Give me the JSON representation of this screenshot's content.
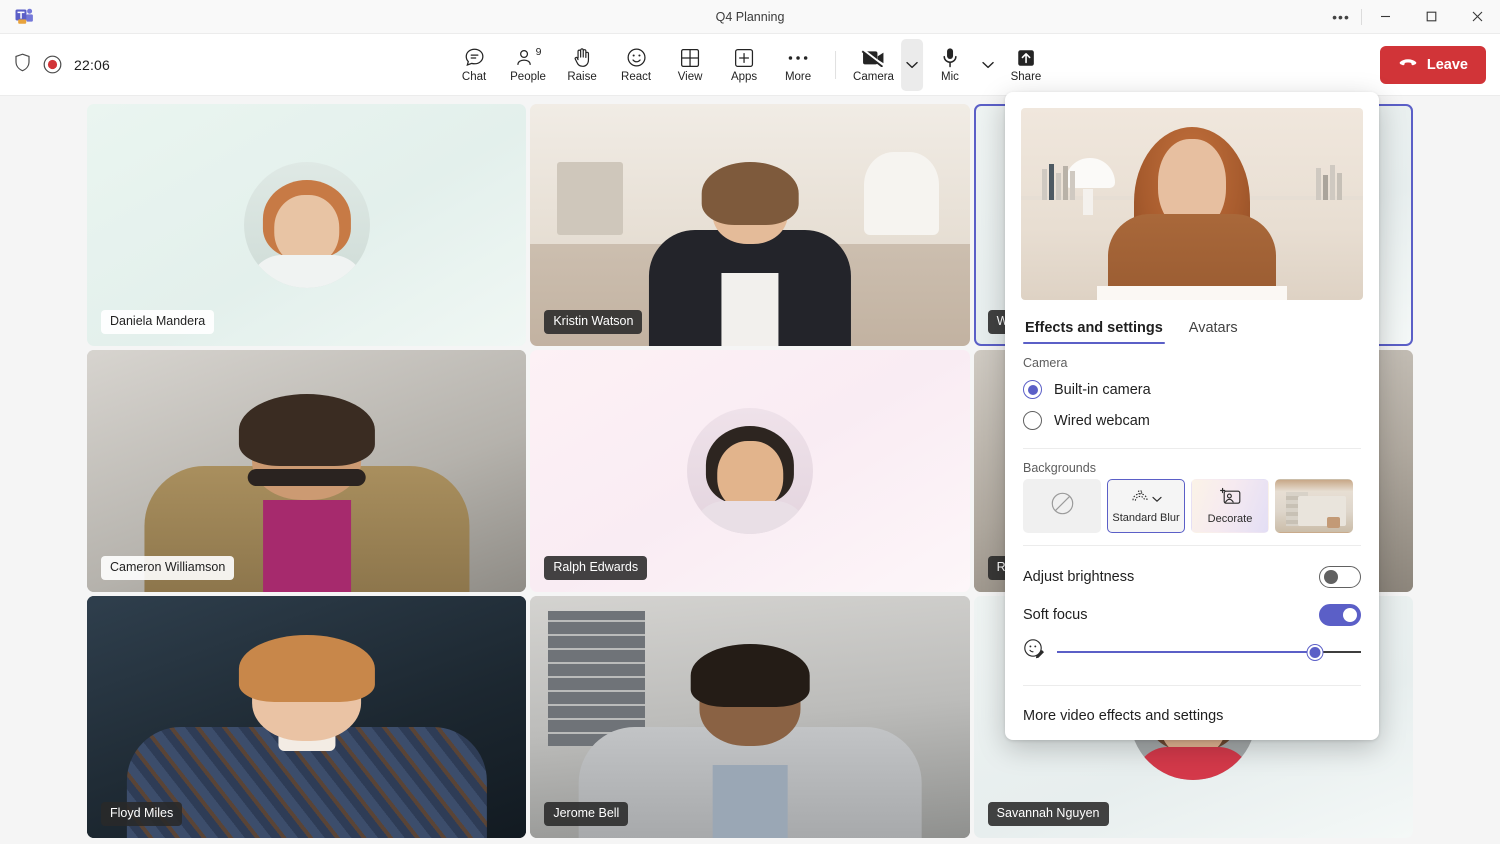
{
  "window": {
    "title": "Q4 Planning",
    "logo_icon": "teams-logo-icon",
    "more_icon": "window-more-icon",
    "minimize_icon": "minimize-icon",
    "maximize_icon": "maximize-icon",
    "close_icon": "close-icon"
  },
  "meeting_bar": {
    "shield_icon": "shield-icon",
    "recording_icon": "recording-dot-icon",
    "timer": "22:06",
    "tools": [
      {
        "label": "Chat",
        "icon": "chat-icon"
      },
      {
        "label": "People",
        "icon": "people-icon",
        "badge": "9"
      },
      {
        "label": "Raise",
        "icon": "raise-hand-icon"
      },
      {
        "label": "React",
        "icon": "react-smiley-icon"
      },
      {
        "label": "View",
        "icon": "view-grid-icon"
      },
      {
        "label": "Apps",
        "icon": "apps-plus-icon"
      },
      {
        "label": "More",
        "icon": "more-ellipsis-icon"
      }
    ],
    "camera": {
      "label": "Camera",
      "icon": "camera-off-icon",
      "chevron_icon": "chevron-down-icon",
      "state": "off"
    },
    "mic": {
      "label": "Mic",
      "icon": "microphone-icon",
      "chevron_icon": "chevron-down-icon"
    },
    "share": {
      "label": "Share",
      "icon": "share-screen-icon"
    },
    "leave": {
      "label": "Leave",
      "icon": "phone-hangup-icon",
      "color": "#d13438"
    }
  },
  "stage": {
    "participants": [
      {
        "name": "Daniela Mandera",
        "kind": "avatar",
        "label_style": "light",
        "bg": "bg-mint",
        "active": false,
        "avatar": {
          "skin": "#e8c4a4",
          "hair": "#c77a45",
          "body": "#f0f3f2"
        }
      },
      {
        "name": "Kristin Watson",
        "kind": "video",
        "label_style": "dark",
        "bg": "bg-room",
        "active": false,
        "avatar": {
          "skin": "#e4bb99",
          "hair": "#7e5a3c",
          "body": "#23242a"
        }
      },
      {
        "name": "Wade Warren",
        "kind": "avatar",
        "label_style": "dark",
        "bg": "bg-mist",
        "active": true,
        "avatar": {
          "skin": "#e6bd9c",
          "hair": "#5c4433",
          "body": "#dfe6e5"
        }
      },
      {
        "name": "Cameron Williamson",
        "kind": "video",
        "label_style": "light",
        "bg": "bg-gray",
        "active": false,
        "avatar": {
          "skin": "#cc9a72",
          "hair": "#3a2c22",
          "body": "#9a7d4f"
        }
      },
      {
        "name": "Ralph Edwards",
        "kind": "avatar",
        "label_style": "dark",
        "bg": "bg-pink",
        "active": false,
        "avatar": {
          "skin": "#e2b48c",
          "hair": "#2d2520",
          "body": "#e9dfe6"
        }
      },
      {
        "name": "Released",
        "kind": "video",
        "label_style": "dark",
        "bg": "bg-office",
        "active": false,
        "avatar": {
          "skin": "#dcae88",
          "hair": "#42332a",
          "body": "#b3a494"
        }
      },
      {
        "name": "Floyd Miles",
        "kind": "video",
        "label_style": "dark",
        "bg": "bg-dark",
        "active": false,
        "avatar": {
          "skin": "#eac3a4",
          "hair": "#c8874a",
          "body": "#3b4a63"
        }
      },
      {
        "name": "Jerome Bell",
        "kind": "video",
        "label_style": "dark",
        "bg": "bg-loft",
        "active": false,
        "avatar": {
          "skin": "#8a6244",
          "hair": "#241c16",
          "body": "#b8bbbd"
        }
      },
      {
        "name": "Savannah Nguyen",
        "kind": "avatar",
        "label_style": "dark",
        "bg": "bg-mist",
        "active": false,
        "avatar": {
          "skin": "#e3b592",
          "hair": "#6f4a33",
          "body": "#d4394a"
        }
      }
    ]
  },
  "effects_panel": {
    "preview_icon": "camera-preview",
    "tabs": [
      {
        "label": "Effects and settings",
        "selected": true
      },
      {
        "label": "Avatars",
        "selected": false
      }
    ],
    "camera_section_label": "Camera",
    "camera_options": [
      {
        "label": "Built-in camera",
        "selected": true
      },
      {
        "label": "Wired webcam",
        "selected": false
      }
    ],
    "backgrounds_label": "Backgrounds",
    "backgrounds": [
      {
        "label": "",
        "icon": "no-background-icon",
        "selected": false,
        "style": "none"
      },
      {
        "label": "Standard Blur",
        "icon": "blur-icon",
        "selected": true,
        "style": "blur",
        "chevron_icon": "chevron-down-icon"
      },
      {
        "label": "Decorate",
        "icon": "decorate-icon",
        "selected": false,
        "style": "decorate"
      },
      {
        "label": "",
        "icon": "room-photo-icon",
        "selected": false,
        "style": "photo"
      }
    ],
    "adjust_brightness": {
      "label": "Adjust brightness",
      "on": false
    },
    "soft_focus": {
      "label": "Soft focus",
      "on": true
    },
    "soft_focus_slider": {
      "icon": "soft-focus-icon",
      "value": 85
    },
    "more_link": "More video effects and settings",
    "accent_color": "#5b5fc7"
  }
}
